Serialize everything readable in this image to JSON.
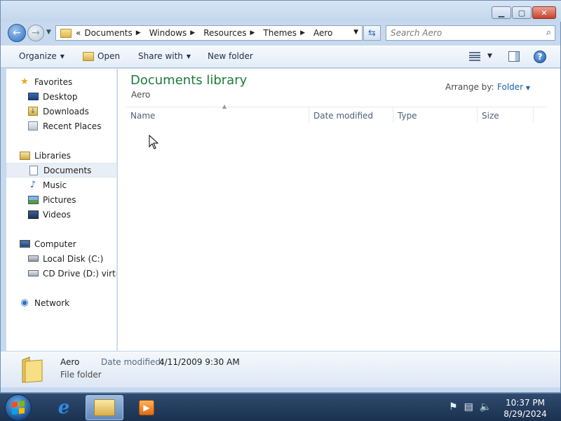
{
  "window": {
    "minimize_icon": "minimize-icon",
    "maximize_icon": "maximize-icon",
    "close_icon": "close-icon"
  },
  "navigation": {
    "breadcrumb": [
      "Documents",
      "Windows",
      "Resources",
      "Themes",
      "Aero"
    ],
    "overflow": "«",
    "search_placeholder": "Search Aero"
  },
  "toolbar": {
    "organize": "Organize",
    "open": "Open",
    "share_with": "Share with",
    "new_folder": "New folder"
  },
  "nav_pane": {
    "favorites": {
      "label": "Favorites",
      "items": [
        "Desktop",
        "Downloads",
        "Recent Places"
      ]
    },
    "libraries": {
      "label": "Libraries",
      "items": [
        "Documents",
        "Music",
        "Pictures",
        "Videos"
      ],
      "selected": "Documents"
    },
    "computer": {
      "label": "Computer",
      "items": [
        "Local Disk (C:)",
        "CD Drive (D:) virtio-w"
      ]
    },
    "network": {
      "label": "Network"
    }
  },
  "content": {
    "library_title": "Documents library",
    "library_subtitle": "Aero",
    "arrange_by_label": "Arrange by:",
    "arrange_by_value": "Folder",
    "columns": [
      "Name",
      "Date modified",
      "Type",
      "Size"
    ]
  },
  "details": {
    "name": "Aero",
    "type": "File folder",
    "modified_label": "Date modified:",
    "modified_value": "4/11/2009 9:30 AM"
  },
  "taskbar": {
    "time": "10:37 PM",
    "date": "8/29/2024"
  },
  "colors": {
    "library_title": "#1e7a3c",
    "link_blue": "#1c5fb0",
    "selection": "#e8eef6",
    "taskbar": "#1b3150"
  }
}
